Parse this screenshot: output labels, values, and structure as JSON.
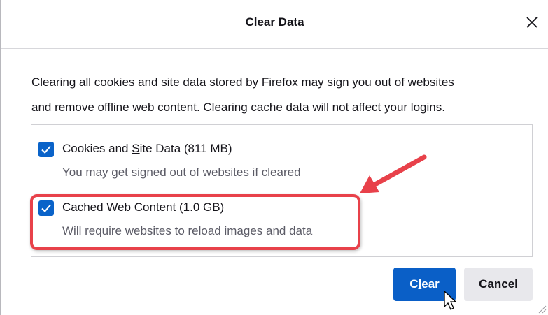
{
  "dialog": {
    "title": "Clear Data",
    "close_icon": "close-icon",
    "intro_line1": "Clearing all cookies and site data stored by Firefox may sign you out of websites",
    "intro_line2": "and remove offline web content. Clearing cache data will not affect your logins."
  },
  "options": [
    {
      "label_pre": "Cookies and ",
      "label_access": "S",
      "label_post": "ite Data (811 MB)",
      "description": "You may get signed out of websites if cleared",
      "checked": true
    },
    {
      "label_pre": "Cached ",
      "label_access": "W",
      "label_post": "eb Content (1.0 GB)",
      "description": "Will require websites to reload images and data",
      "checked": true
    }
  ],
  "buttons": {
    "clear_pre": "C",
    "clear_access": "l",
    "clear_post": "ear",
    "cancel": "Cancel"
  },
  "colors": {
    "accent": "#0a5fc7",
    "annotation": "#e8414a"
  }
}
